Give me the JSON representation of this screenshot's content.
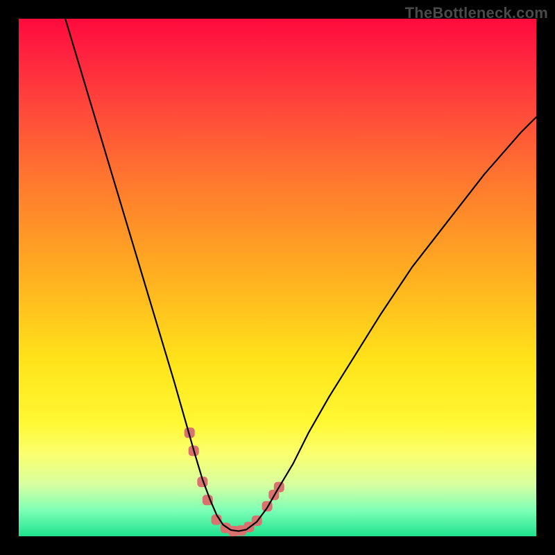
{
  "watermark": "TheBottleneck.com",
  "chart_data": {
    "type": "line",
    "title": "",
    "xlabel": "",
    "ylabel": "",
    "xlim": [
      0,
      100
    ],
    "ylim": [
      0,
      100
    ],
    "grid": false,
    "series": [
      {
        "name": "curve",
        "color": "#000000",
        "x": [
          9,
          12,
          15,
          18,
          21,
          24,
          27,
          30,
          32,
          34,
          35.5,
          37,
          38.3,
          39.5,
          41,
          42.5,
          44,
          46,
          48,
          50,
          53,
          56,
          60,
          65,
          70,
          76,
          83,
          90,
          97,
          100
        ],
        "y": [
          100,
          90,
          80,
          70,
          60,
          50,
          40,
          30,
          23,
          16,
          11,
          7,
          4,
          2.2,
          1.2,
          1.0,
          1.3,
          2.8,
          5.5,
          9,
          14,
          20,
          27,
          35,
          43,
          52,
          61,
          70,
          78,
          81
        ]
      }
    ],
    "markers": {
      "name": "highlight-markers",
      "color": "#d9716e",
      "points": [
        {
          "x": 33.0,
          "y": 20.0
        },
        {
          "x": 33.8,
          "y": 16.5
        },
        {
          "x": 35.5,
          "y": 10.5
        },
        {
          "x": 36.5,
          "y": 7.0
        },
        {
          "x": 38.2,
          "y": 3.2
        },
        {
          "x": 40.0,
          "y": 1.6
        },
        {
          "x": 41.5,
          "y": 1.0
        },
        {
          "x": 43.0,
          "y": 1.1
        },
        {
          "x": 44.5,
          "y": 1.8
        },
        {
          "x": 46.0,
          "y": 3.0
        },
        {
          "x": 48.0,
          "y": 5.8
        },
        {
          "x": 49.3,
          "y": 8.0
        },
        {
          "x": 50.3,
          "y": 9.5
        }
      ]
    },
    "gradient_stops": [
      {
        "pos": 0.0,
        "color": "#ff0a3c"
      },
      {
        "pos": 0.06,
        "color": "#ff2040"
      },
      {
        "pos": 0.18,
        "color": "#ff4a3a"
      },
      {
        "pos": 0.32,
        "color": "#ff7a2e"
      },
      {
        "pos": 0.5,
        "color": "#ffb020"
      },
      {
        "pos": 0.66,
        "color": "#ffe31a"
      },
      {
        "pos": 0.78,
        "color": "#fff833"
      },
      {
        "pos": 0.84,
        "color": "#fbff6e"
      },
      {
        "pos": 0.9,
        "color": "#d8ffa0"
      },
      {
        "pos": 0.95,
        "color": "#7dffb7"
      },
      {
        "pos": 1.0,
        "color": "#1ee28e"
      }
    ]
  }
}
